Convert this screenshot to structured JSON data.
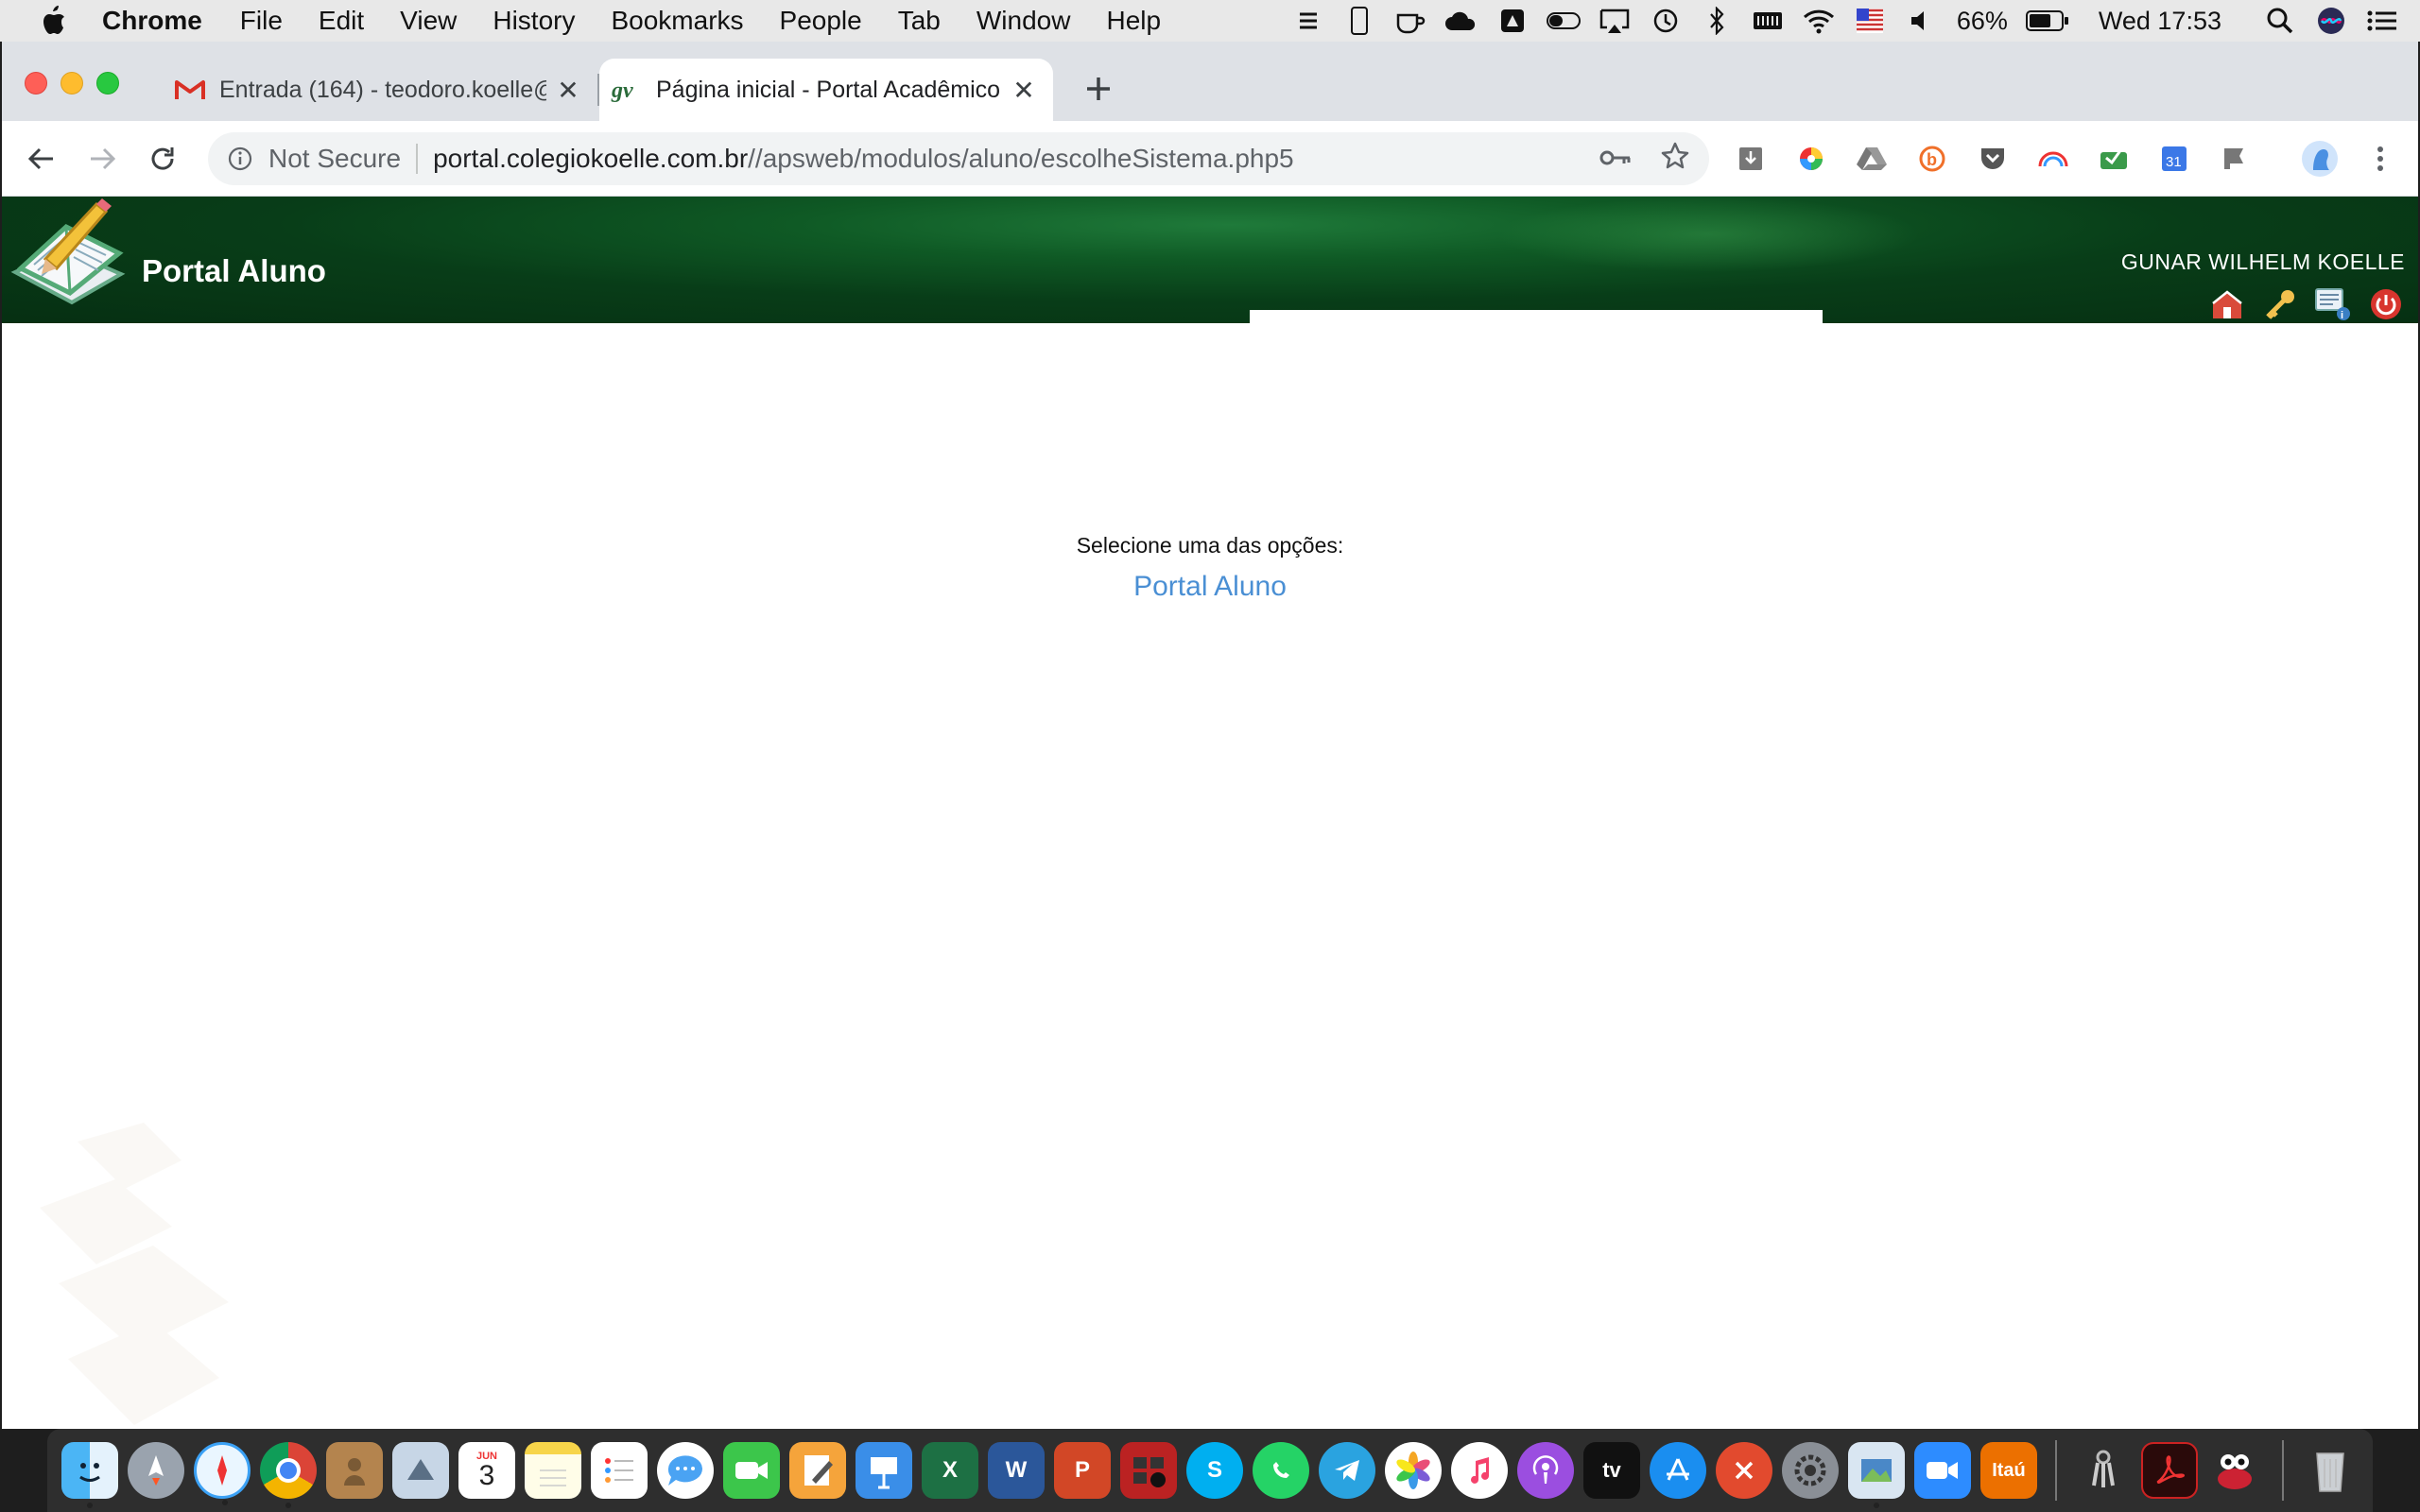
{
  "menubar": {
    "app_name": "Chrome",
    "menus": [
      "File",
      "Edit",
      "View",
      "History",
      "Bookmarks",
      "People",
      "Tab",
      "Window",
      "Help"
    ],
    "battery": "66%",
    "clock": "Wed 17:53"
  },
  "browser": {
    "tabs": [
      {
        "title": "Entrada (164) - teodoro.koelle@",
        "favicon": "gmail-icon",
        "active": false
      },
      {
        "title": "Página inicial - Portal Acadêmico",
        "favicon": "gv-icon",
        "active": true
      }
    ],
    "omnibox": {
      "security_label": "Not Secure",
      "host": "portal.colegiokoelle.com.br",
      "path": "//apsweb/modulos/aluno/escolheSistema.php5"
    }
  },
  "page": {
    "banner_title": "Portal Aluno",
    "user_name": "GUNAR WILHELM KOELLE",
    "prompt": "Selecione uma das opções:",
    "option_link": "Portal Aluno"
  },
  "colors": {
    "banner_green": "#083d18",
    "link_blue": "#4a8fd4"
  },
  "dock": {
    "calendar_month": "JUN",
    "calendar_day": "3",
    "bank_label": "Itaú"
  }
}
